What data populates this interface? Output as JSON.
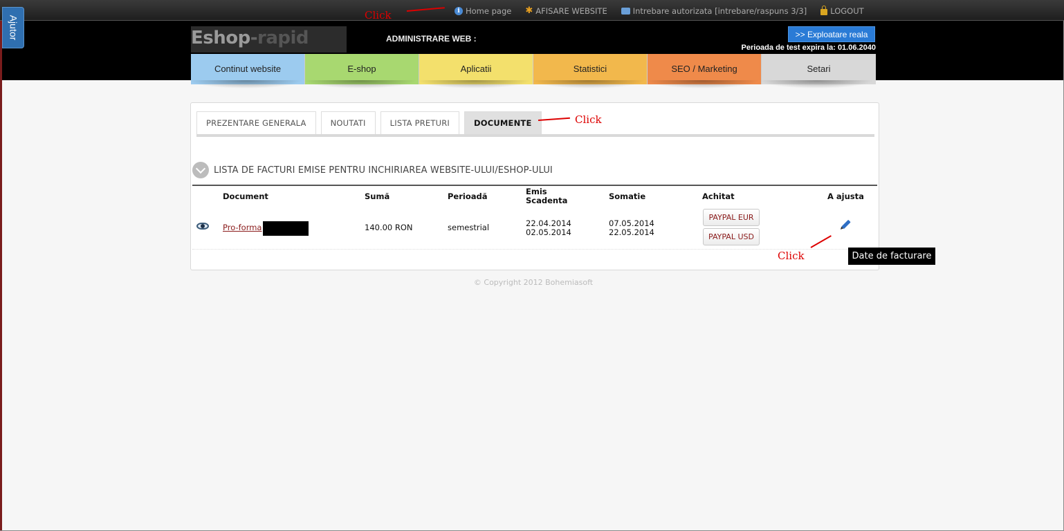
{
  "sidebar_tab": {
    "label": "Ajutor"
  },
  "top_links": {
    "home": "Home page",
    "website": "AFISARE WEBSITE",
    "question": "Intrebare autorizata [intrebare/raspuns 3/3]",
    "logout": "LOGOUT"
  },
  "header": {
    "logo_a": "Eshop",
    "logo_dash": "-",
    "logo_b": "rapid",
    "admin_label": "ADMINISTRARE WEB :",
    "exploit_button": ">> Exploatare reala",
    "test_expire": "Perioada de test expira la: 01.06.2040"
  },
  "main_nav": [
    {
      "label": "Continut website",
      "color": "#9ccbef"
    },
    {
      "label": "E-shop",
      "color": "#a8d870"
    },
    {
      "label": "Aplicatii",
      "color": "#f3e06c"
    },
    {
      "label": "Statistici",
      "color": "#f2b84c"
    },
    {
      "label": "SEO / Marketing",
      "color": "#ef8a4a"
    },
    {
      "label": "Setari",
      "color": "#d8d8d8"
    }
  ],
  "sub_tabs": [
    "PREZENTARE GENERALA",
    "NOUTATI",
    "LISTA PRETURI",
    "DOCUMENTE"
  ],
  "section_title": "LISTA DE FACTURI EMISE PENTRU INCHIRIAREA WEBSITE-ULUI/ESHOP-ULUI",
  "table": {
    "headers": {
      "document": "Document",
      "suma": "Sumă",
      "perioada": "Perioadă",
      "emis": "Emis",
      "scadenta": "Scadenta",
      "somatie": "Somatie",
      "achitat": "Achitat",
      "ajusta": "A ajusta"
    },
    "row": {
      "document": "Pro-forma",
      "suma": "140.00 RON",
      "perioada": "semestrial",
      "emis": "22.04.2014",
      "scadenta": "02.05.2014",
      "somatie_1": "07.05.2014",
      "somatie_2": "22.05.2014",
      "paypal_eur": "PAYPAL EUR",
      "paypal_usd": "PAYPAL USD"
    }
  },
  "tooltip": "Date de facturare",
  "copyright": "© Copyright 2012 Bohemiasoft",
  "annotations": {
    "click": "Click"
  }
}
